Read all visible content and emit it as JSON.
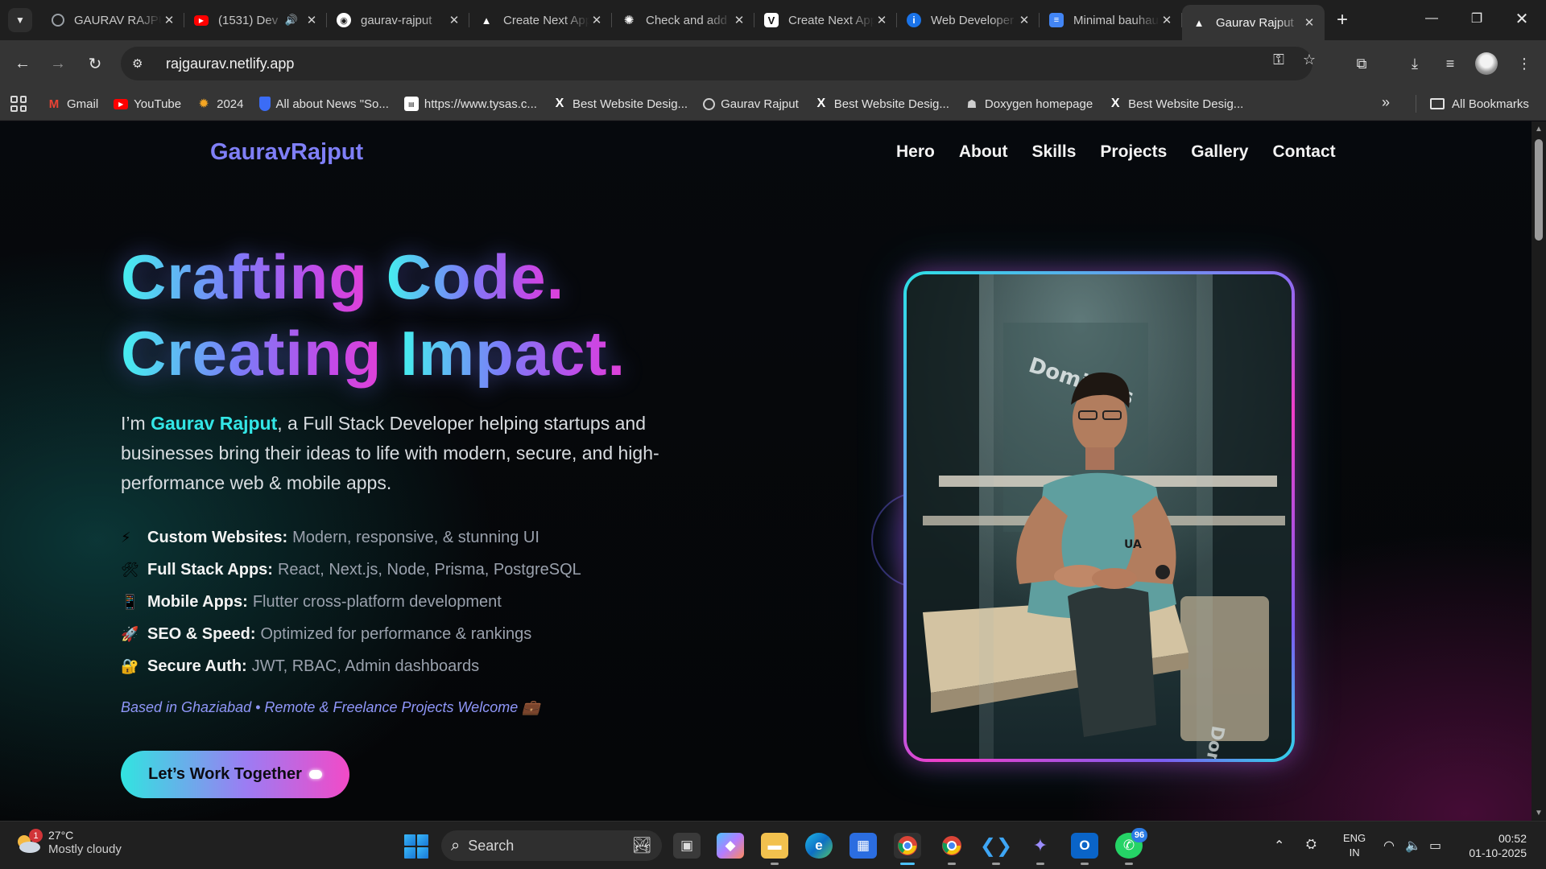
{
  "browser": {
    "tabs": [
      {
        "title": "GAURAV RAJPUT",
        "favicon": "globe-icon",
        "color": "#9aa0a6",
        "audio": false
      },
      {
        "title": "(1531) Dev",
        "favicon": "youtube-icon",
        "color": "#ff0000",
        "audio": true
      },
      {
        "title": "gaurav-rajput",
        "favicon": "github-icon",
        "color": "#ffffff",
        "audio": false
      },
      {
        "title": "Create Next App",
        "favicon": "triangle-icon",
        "color": "#ffffff",
        "audio": false
      },
      {
        "title": "Check and add",
        "favicon": "openai-icon",
        "color": "#ffffff",
        "audio": false
      },
      {
        "title": "Create Next App",
        "favicon": "v-icon",
        "color": "#ffffff",
        "audio": false
      },
      {
        "title": "Web Developer",
        "favicon": "info-icon",
        "color": "#1a73e8",
        "audio": false
      },
      {
        "title": "Minimal bauhaus",
        "favicon": "docs-icon",
        "color": "#4285f4",
        "audio": false
      },
      {
        "title": "Gaurav Rajput",
        "favicon": "triangle-icon",
        "color": "#ffffff",
        "audio": false,
        "active": true
      }
    ],
    "address": "rajgaurav.netlify.app",
    "bookmarks": [
      {
        "label": "Gmail",
        "icon": "gmail-icon",
        "color": "#ea4335"
      },
      {
        "label": "YouTube",
        "icon": "youtube-icon",
        "color": "#ff0000"
      },
      {
        "label": "2024",
        "icon": "sun-icon",
        "color": "#f5a623"
      },
      {
        "label": "All about News \"So...",
        "icon": "shield-icon",
        "color": "#3b6cf6"
      },
      {
        "label": "https://www.tysas.c...",
        "icon": "tysas-icon",
        "color": "#ffffff"
      },
      {
        "label": "Best Website Desig...",
        "icon": "x-icon",
        "color": "#ffffff"
      },
      {
        "label": "Gaurav Rajput",
        "icon": "globe-icon",
        "color": "#cfcfcf"
      },
      {
        "label": "Best Website Desig...",
        "icon": "x-icon",
        "color": "#ffffff"
      },
      {
        "label": "Doxygen homepage",
        "icon": "doxygen-icon",
        "color": "#cfcfcf"
      },
      {
        "label": "Best Website Desig...",
        "icon": "x-icon",
        "color": "#ffffff"
      }
    ],
    "all_bookmarks": "All Bookmarks"
  },
  "site": {
    "logo": "GauravRajput",
    "nav": [
      "Hero",
      "About",
      "Skills",
      "Projects",
      "Gallery",
      "Contact"
    ],
    "headline_1a": "Crafting",
    "headline_1b": "Code.",
    "headline_2a": "Creating",
    "headline_2b": "Impact.",
    "intro_prefix": "I’m ",
    "intro_name": "Gaurav Rajput",
    "intro_suffix": ", a Full Stack Developer helping startups and businesses bring their ideas to life with modern, secure, and high-performance web & mobile apps.",
    "features": [
      {
        "icon": "⚡",
        "label": "Custom Websites:",
        "desc": "Modern, responsive, & stunning UI"
      },
      {
        "icon": "🛠",
        "label": "Full Stack Apps:",
        "desc": "React, Next.js, Node, Prisma, PostgreSQL"
      },
      {
        "icon": "📱",
        "label": "Mobile Apps:",
        "desc": "Flutter cross-platform development"
      },
      {
        "icon": "🚀",
        "label": "SEO & Speed:",
        "desc": "Optimized for performance & rankings"
      },
      {
        "icon": "🔐",
        "label": "Secure Auth:",
        "desc": "JWT, RBAC, Admin dashboards"
      }
    ],
    "location": "Based in Ghaziabad • Remote & Freelance Projects Welcome 💼",
    "cta": "Let’s Work Together",
    "accent_cyan": "#33e6e6",
    "accent_purple": "#7b7cf8",
    "accent_pink": "#e040d8"
  },
  "taskbar": {
    "weather_temp": "27°C",
    "weather_cond": "Mostly cloudy",
    "weather_badge": "1",
    "search_placeholder": "Search",
    "whatsapp_count": "96",
    "lang_1": "ENG",
    "lang_2": "IN",
    "time": "00:52",
    "date": "01-10-2025"
  }
}
